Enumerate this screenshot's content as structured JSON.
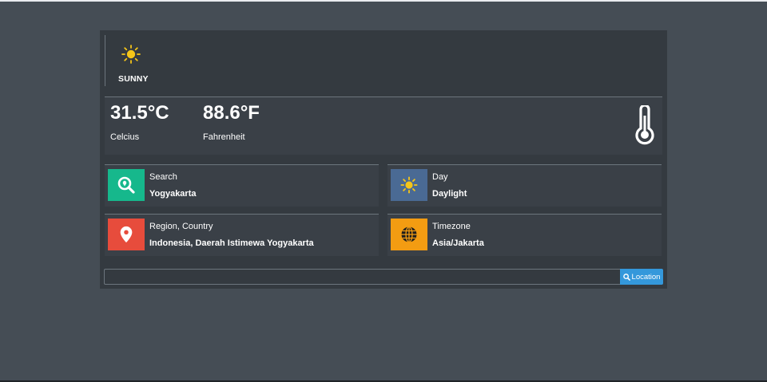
{
  "weather": {
    "condition": "SUNNY",
    "condition_icon": "sun-icon",
    "celsius_value": "31.5°C",
    "celsius_label": "Celcius",
    "fahrenheit_value": "88.6°F",
    "fahrenheit_label": "Fahrenheit",
    "temperature_icon": "thermometer-icon"
  },
  "cards": {
    "search": {
      "title": "Search",
      "value": "Yogyakarta",
      "icon": "search-location-icon",
      "color": "#16b88c"
    },
    "day": {
      "title": "Day",
      "value": "Daylight",
      "icon": "sun-icon",
      "color": "#4a6a94"
    },
    "region": {
      "title": "Region, Country",
      "value": "Indonesia, Daerah Istimewa Yogyakarta",
      "icon": "map-marker-icon",
      "color": "#e74c3c"
    },
    "timezone": {
      "title": "Timezone",
      "value": "Asia/Jakarta",
      "icon": "globe-icon",
      "color": "#f39c12"
    }
  },
  "search": {
    "input_value": "",
    "placeholder": "",
    "button_label": "Location",
    "button_icon": "search-icon",
    "button_color": "#3498db"
  },
  "colors": {
    "page_background": "#454d55",
    "panel_background": "#343a40",
    "sun_yellow": "#f5c518"
  }
}
